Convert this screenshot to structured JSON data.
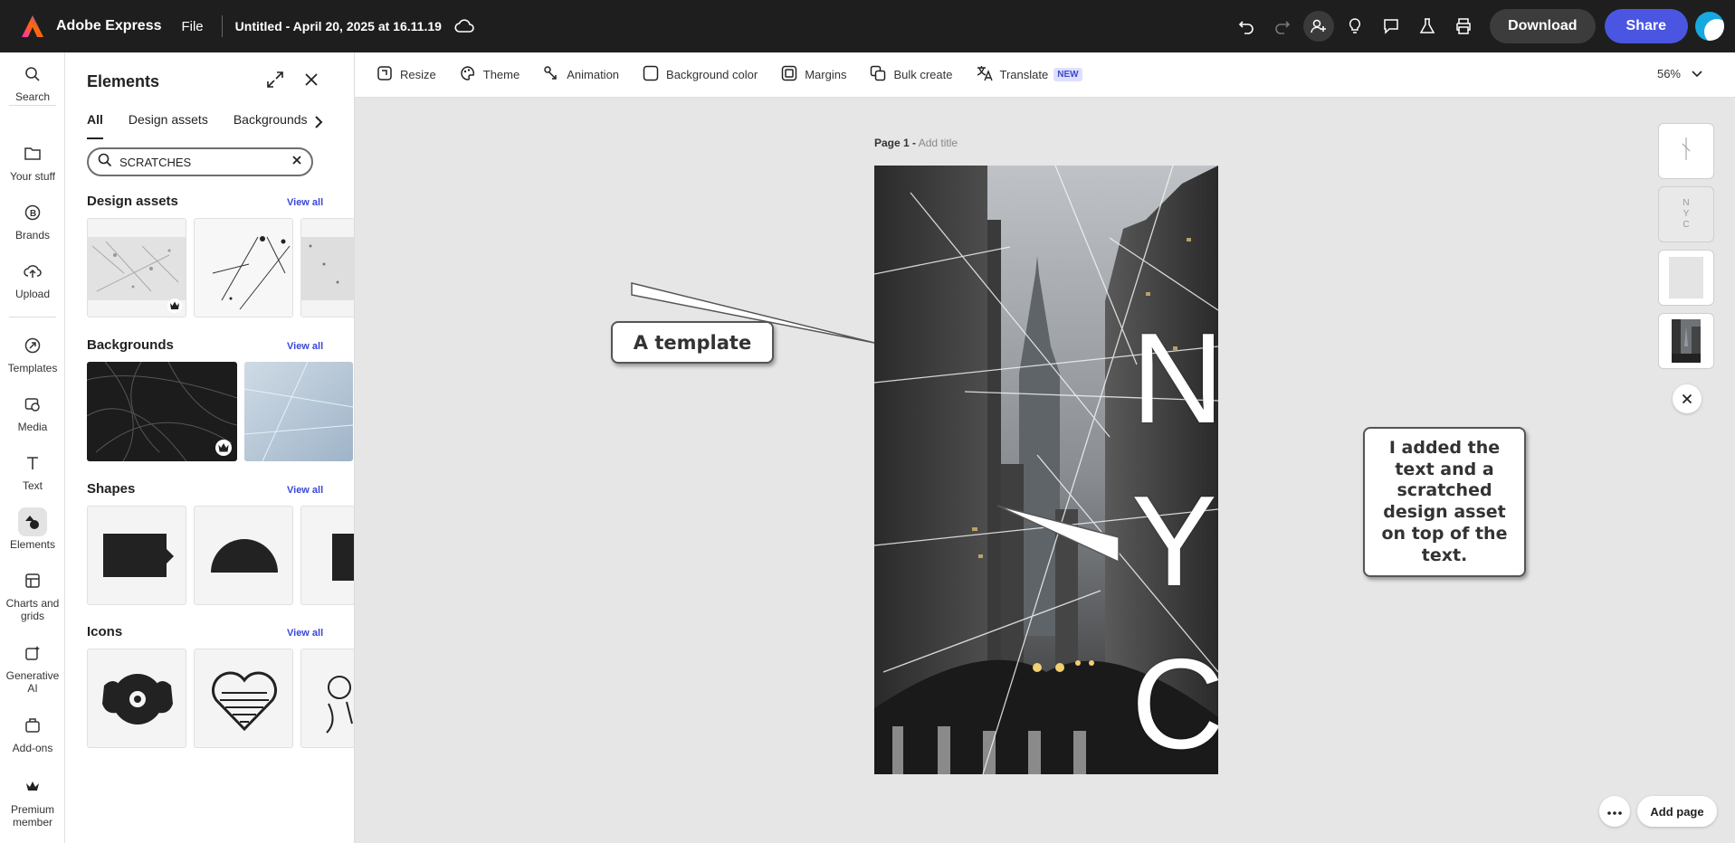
{
  "app": {
    "name": "Adobe Express",
    "file_menu": "File",
    "doc_title": "Untitled - April 20, 2025 at 16.11.19",
    "download": "Download",
    "share": "Share"
  },
  "rail": [
    {
      "label": "Search",
      "icon": "search-icon"
    },
    {
      "label": "Your stuff",
      "icon": "folder-icon"
    },
    {
      "label": "Brands",
      "icon": "brand-icon"
    },
    {
      "label": "Upload",
      "icon": "upload-icon"
    },
    {
      "label": "Templates",
      "icon": "templates-icon"
    },
    {
      "label": "Media",
      "icon": "media-icon"
    },
    {
      "label": "Text",
      "icon": "text-icon"
    },
    {
      "label": "Elements",
      "icon": "elements-icon",
      "active": true
    },
    {
      "label": "Charts and grids",
      "icon": "charts-icon"
    },
    {
      "label": "Generative AI",
      "icon": "generative-ai-icon"
    },
    {
      "label": "Add-ons",
      "icon": "addons-icon"
    },
    {
      "label": "Premium member",
      "icon": "crown-icon"
    }
  ],
  "panel": {
    "title": "Elements",
    "tabs": [
      "All",
      "Design assets",
      "Backgrounds"
    ],
    "active_tab": "All",
    "search_value": "SCRATCHES",
    "view_all": "View all",
    "sections": {
      "design_assets": "Design assets",
      "backgrounds": "Backgrounds",
      "shapes": "Shapes",
      "icons": "Icons"
    }
  },
  "toolbar": {
    "items": [
      "Resize",
      "Theme",
      "Animation",
      "Background color",
      "Margins",
      "Bulk create",
      "Translate"
    ],
    "new_badge": "NEW",
    "zoom": "56%"
  },
  "page": {
    "label": "Page 1 -",
    "add_title": "Add title",
    "letters": [
      "N",
      "Y",
      "C"
    ]
  },
  "callouts": {
    "template": "A template",
    "note": "I added the text and a scratched design asset on top of the text."
  },
  "thumbs": {
    "mini_letters": [
      "N",
      "Y",
      "C"
    ]
  },
  "bottom": {
    "add_page": "Add page"
  }
}
